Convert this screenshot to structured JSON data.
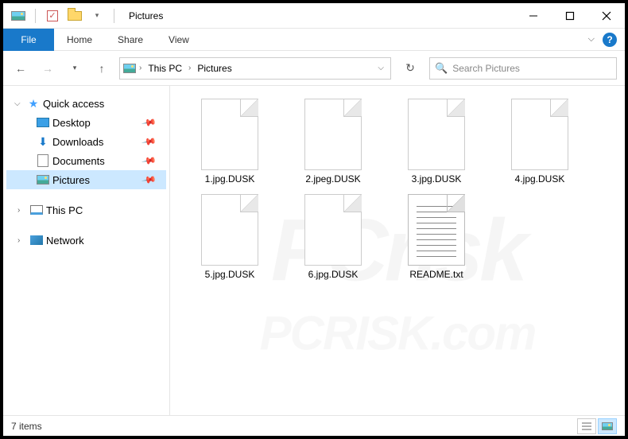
{
  "titlebar": {
    "title": "Pictures"
  },
  "ribbon": {
    "file": "File",
    "tabs": [
      "Home",
      "Share",
      "View"
    ]
  },
  "address": {
    "segments": [
      "This PC",
      "Pictures"
    ],
    "search_placeholder": "Search Pictures"
  },
  "nav": {
    "quick_access": "Quick access",
    "items": [
      {
        "label": "Desktop"
      },
      {
        "label": "Downloads"
      },
      {
        "label": "Documents"
      },
      {
        "label": "Pictures"
      }
    ],
    "this_pc": "This PC",
    "network": "Network"
  },
  "files": [
    {
      "name": "1.jpg.DUSK",
      "type": "blank"
    },
    {
      "name": "2.jpeg.DUSK",
      "type": "blank"
    },
    {
      "name": "3.jpg.DUSK",
      "type": "blank"
    },
    {
      "name": "4.jpg.DUSK",
      "type": "blank"
    },
    {
      "name": "5.jpg.DUSK",
      "type": "blank"
    },
    {
      "name": "6.jpg.DUSK",
      "type": "blank"
    },
    {
      "name": "README.txt",
      "type": "txt"
    }
  ],
  "status": {
    "count": "7 items"
  },
  "watermark": {
    "big": "PCrisk",
    "small": "PCRISK.com"
  }
}
